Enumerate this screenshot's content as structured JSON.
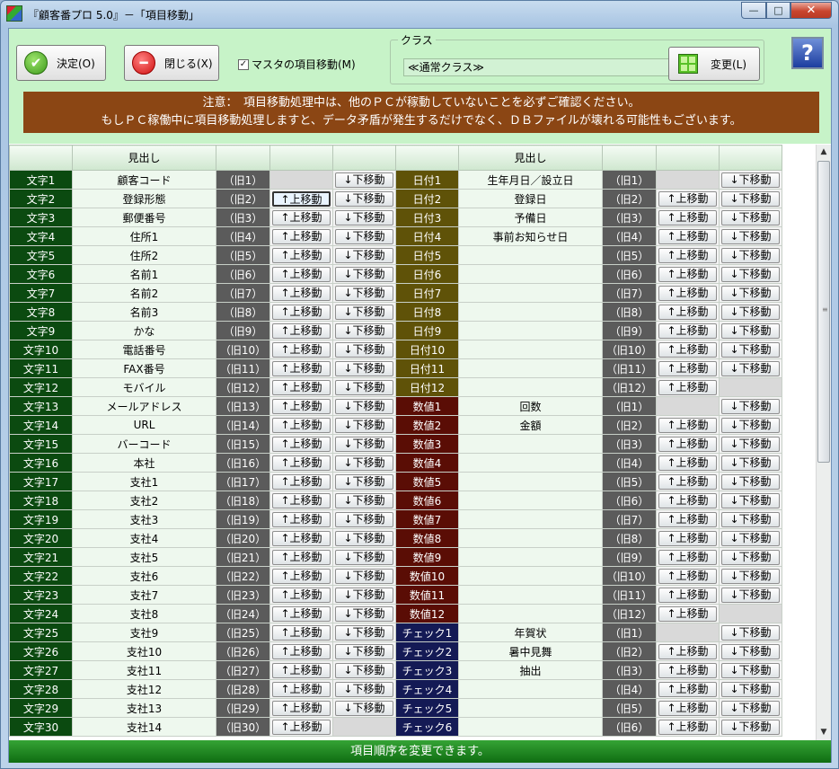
{
  "window": {
    "title": "『顧客番プロ 5.0』－「項目移動」",
    "minimize_glyph": "—",
    "maximize_glyph": "□",
    "close_glyph": "✕"
  },
  "toolbar": {
    "ok_label": "決定(O)",
    "ok_icon_glyph": "✔",
    "close_label": "閉じる(X)",
    "close_icon_glyph": "━",
    "master_label": "マスタの項目移動(M)",
    "master_checked_glyph": "✓",
    "class_label": "クラス",
    "class_value": "≪通常クラス≫",
    "change_label": "変更(L)",
    "help_glyph": "?"
  },
  "notice": {
    "line1": "注意：　項目移動処理中は、他のＰＣが稼動していないことを必ずご確認ください。",
    "line2": "もしＰＣ稼働中に項目移動処理しますと、データ矛盾が発生するだけでなく、ＤＢファイルが壊れる可能性もございます。"
  },
  "grid": {
    "header": {
      "left": "見出し",
      "right": "見出し"
    },
    "up_label": "↑上移動",
    "down_label": "↓下移動",
    "rows": [
      {
        "l_name": "文字1",
        "l_head": "顧客コード",
        "l_old": "（旧1）",
        "r_name": "日付1",
        "r_head": "生年月日／設立日",
        "r_old": "（旧1）"
      },
      {
        "l_name": "文字2",
        "l_head": "登録形態",
        "l_old": "（旧2）",
        "r_name": "日付2",
        "r_head": "登録日",
        "r_old": "（旧2）"
      },
      {
        "l_name": "文字3",
        "l_head": "郵便番号",
        "l_old": "（旧3）",
        "r_name": "日付3",
        "r_head": "予備日",
        "r_old": "（旧3）"
      },
      {
        "l_name": "文字4",
        "l_head": "住所1",
        "l_old": "（旧4）",
        "r_name": "日付4",
        "r_head": "事前お知らせ日",
        "r_old": "（旧4）"
      },
      {
        "l_name": "文字5",
        "l_head": "住所2",
        "l_old": "（旧5）",
        "r_name": "日付5",
        "r_head": "",
        "r_old": "（旧5）"
      },
      {
        "l_name": "文字6",
        "l_head": "名前1",
        "l_old": "（旧6）",
        "r_name": "日付6",
        "r_head": "",
        "r_old": "（旧6）"
      },
      {
        "l_name": "文字7",
        "l_head": "名前2",
        "l_old": "（旧7）",
        "r_name": "日付7",
        "r_head": "",
        "r_old": "（旧7）"
      },
      {
        "l_name": "文字8",
        "l_head": "名前3",
        "l_old": "（旧8）",
        "r_name": "日付8",
        "r_head": "",
        "r_old": "（旧8）"
      },
      {
        "l_name": "文字9",
        "l_head": "かな",
        "l_old": "（旧9）",
        "r_name": "日付9",
        "r_head": "",
        "r_old": "（旧9）"
      },
      {
        "l_name": "文字10",
        "l_head": "電話番号",
        "l_old": "（旧10）",
        "r_name": "日付10",
        "r_head": "",
        "r_old": "（旧10）"
      },
      {
        "l_name": "文字11",
        "l_head": "FAX番号",
        "l_old": "（旧11）",
        "r_name": "日付11",
        "r_head": "",
        "r_old": "（旧11）"
      },
      {
        "l_name": "文字12",
        "l_head": "モバイル",
        "l_old": "（旧12）",
        "r_name": "日付12",
        "r_head": "",
        "r_old": "（旧12）"
      },
      {
        "l_name": "文字13",
        "l_head": "メールアドレス",
        "l_old": "（旧13）",
        "r_name": "数値1",
        "r_head": "回数",
        "r_old": "（旧1）"
      },
      {
        "l_name": "文字14",
        "l_head": "URL",
        "l_old": "（旧14）",
        "r_name": "数値2",
        "r_head": "金額",
        "r_old": "（旧2）"
      },
      {
        "l_name": "文字15",
        "l_head": "バーコード",
        "l_old": "（旧15）",
        "r_name": "数値3",
        "r_head": "",
        "r_old": "（旧3）"
      },
      {
        "l_name": "文字16",
        "l_head": "本社",
        "l_old": "（旧16）",
        "r_name": "数値4",
        "r_head": "",
        "r_old": "（旧4）"
      },
      {
        "l_name": "文字17",
        "l_head": "支社1",
        "l_old": "（旧17）",
        "r_name": "数値5",
        "r_head": "",
        "r_old": "（旧5）"
      },
      {
        "l_name": "文字18",
        "l_head": "支社2",
        "l_old": "（旧18）",
        "r_name": "数値6",
        "r_head": "",
        "r_old": "（旧6）"
      },
      {
        "l_name": "文字19",
        "l_head": "支社3",
        "l_old": "（旧19）",
        "r_name": "数値7",
        "r_head": "",
        "r_old": "（旧7）"
      },
      {
        "l_name": "文字20",
        "l_head": "支社4",
        "l_old": "（旧20）",
        "r_name": "数値8",
        "r_head": "",
        "r_old": "（旧8）"
      },
      {
        "l_name": "文字21",
        "l_head": "支社5",
        "l_old": "（旧21）",
        "r_name": "数値9",
        "r_head": "",
        "r_old": "（旧9）"
      },
      {
        "l_name": "文字22",
        "l_head": "支社6",
        "l_old": "（旧22）",
        "r_name": "数値10",
        "r_head": "",
        "r_old": "（旧10）"
      },
      {
        "l_name": "文字23",
        "l_head": "支社7",
        "l_old": "（旧23）",
        "r_name": "数値11",
        "r_head": "",
        "r_old": "（旧11）"
      },
      {
        "l_name": "文字24",
        "l_head": "支社8",
        "l_old": "（旧24）",
        "r_name": "数値12",
        "r_head": "",
        "r_old": "（旧12）"
      },
      {
        "l_name": "文字25",
        "l_head": "支社9",
        "l_old": "（旧25）",
        "r_name": "チェック1",
        "r_head": "年賀状",
        "r_old": "（旧1）"
      },
      {
        "l_name": "文字26",
        "l_head": "支社10",
        "l_old": "（旧26）",
        "r_name": "チェック2",
        "r_head": "暑中見舞",
        "r_old": "（旧2）"
      },
      {
        "l_name": "文字27",
        "l_head": "支社11",
        "l_old": "（旧27）",
        "r_name": "チェック3",
        "r_head": "抽出",
        "r_old": "（旧3）"
      },
      {
        "l_name": "文字28",
        "l_head": "支社12",
        "l_old": "（旧28）",
        "r_name": "チェック4",
        "r_head": "",
        "r_old": "（旧4）"
      },
      {
        "l_name": "文字29",
        "l_head": "支社13",
        "l_old": "（旧29）",
        "r_name": "チェック5",
        "r_head": "",
        "r_old": "（旧5）"
      },
      {
        "l_name": "文字30",
        "l_head": "支社14",
        "l_old": "（旧30）",
        "r_name": "チェック6",
        "r_head": "",
        "r_old": "（旧6）"
      }
    ]
  },
  "scrollbar": {
    "up_glyph": "▲",
    "down_glyph": "▼",
    "grip_glyph": "≡"
  },
  "status": "項目順序を変更できます。",
  "colors": {
    "toolbar_bg": "#c7f3c8",
    "notice_bg": "#8b4614",
    "text_field_bg": "#0b4a10",
    "date_field_bg": "#5f5208",
    "number_field_bg": "#5a0d05",
    "check_field_bg": "#141a55",
    "status_bg": "#1a7d1c"
  }
}
